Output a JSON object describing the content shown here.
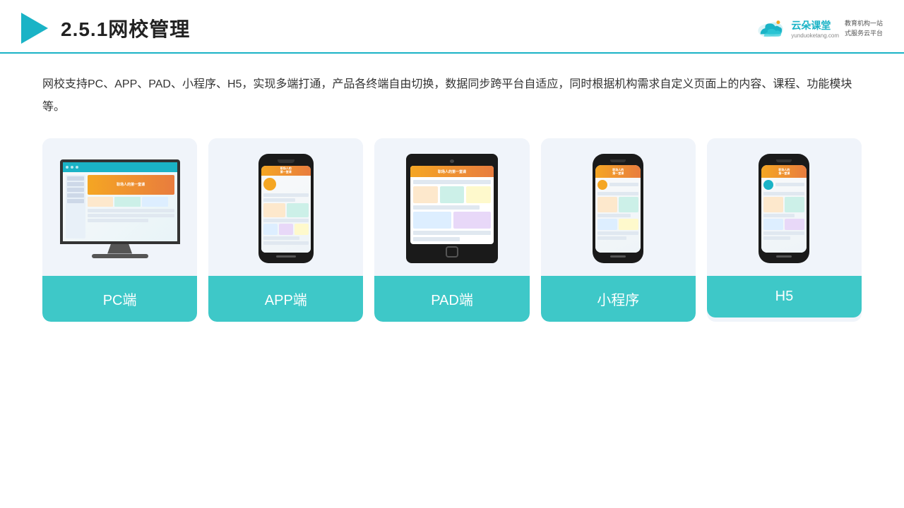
{
  "header": {
    "title": "2.5.1网校管理",
    "logo_brand": "云朵课堂",
    "logo_url": "yunduoketang.com",
    "logo_slogan": "教育机构一站\n式服务云平台"
  },
  "description": "网校支持PC、APP、PAD、小程序、H5，实现多端打通，产品各终端自由切换，数据同步跨平台自适应，同时根据机构需求自定义页面上的内容、课程、功能模块等。",
  "cards": [
    {
      "id": "pc",
      "label": "PC端",
      "type": "pc"
    },
    {
      "id": "app",
      "label": "APP端",
      "type": "phone"
    },
    {
      "id": "pad",
      "label": "PAD端",
      "type": "tablet"
    },
    {
      "id": "miniprogram",
      "label": "小程序",
      "type": "thin-phone"
    },
    {
      "id": "h5",
      "label": "H5",
      "type": "thin-phone-2"
    }
  ],
  "accent_color": "#3ec8c8"
}
